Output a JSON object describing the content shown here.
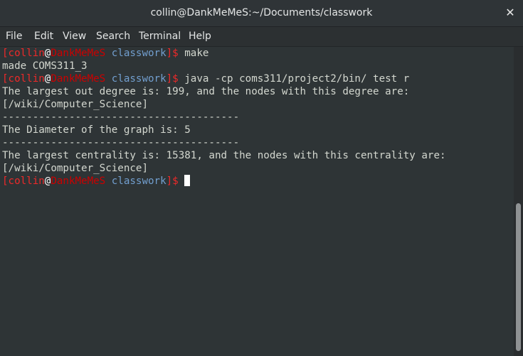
{
  "window": {
    "title": "collin@DankMeMeS:~/Documents/classwork",
    "close_glyph": "✕"
  },
  "menu": {
    "items": [
      "File",
      "Edit",
      "View",
      "Search",
      "Terminal",
      "Help"
    ]
  },
  "prompt": {
    "open_bracket": "[",
    "user": "collin",
    "at": "@",
    "host": "DankMeMeS",
    "dir": " classwork",
    "close": "]$ "
  },
  "terminal": {
    "cmd1": "make",
    "out1": "made COMS311_3",
    "cmd2": "java -cp coms311/project2/bin/ test r",
    "out2": "The largest out degree is: 199, and the nodes with this degree are:",
    "out3": "[/wiki/Computer_Science]",
    "out4": "---------------------------------------",
    "out5": "The Diameter of the graph is: 5",
    "out6": "---------------------------------------",
    "out7": "The largest centrality is: 15381, and the nodes with this centrality are:",
    "out8": "[/wiki/Computer_Science]"
  },
  "colors": {
    "background": "#2e3436",
    "foreground": "#d3d7cf",
    "prompt_red": "#ef2929",
    "host_red": "#cc0000",
    "dir_blue": "#729fcf"
  }
}
